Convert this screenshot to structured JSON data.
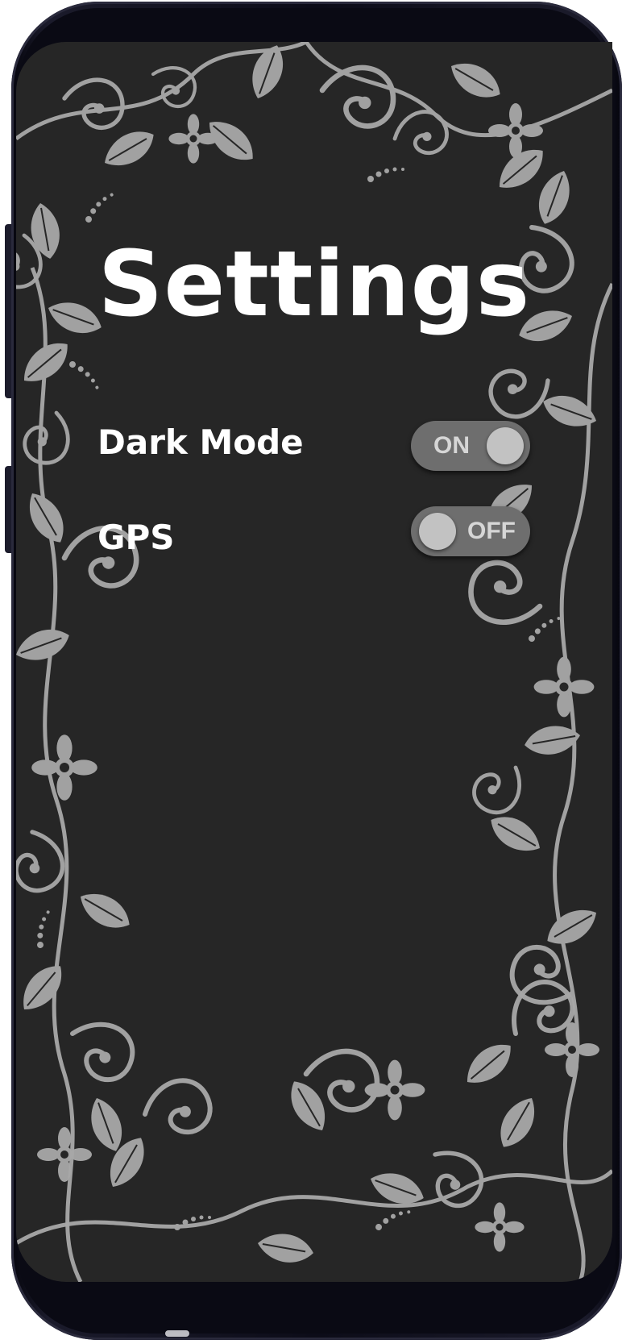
{
  "screen": {
    "title": "Settings",
    "settings": [
      {
        "label": "Dark Mode",
        "toggle_state": "ON",
        "enabled": true
      },
      {
        "label": "GPS",
        "toggle_state": "OFF",
        "enabled": false
      }
    ]
  },
  "colors": {
    "background": "#262626",
    "ornament": "#a8a8a8",
    "text": "#ffffff",
    "toggle_track": "#6e6e6e",
    "toggle_knob": "#c2c2c2",
    "phone_frame": "#0c0c18"
  },
  "icons": {
    "background": "floral-ornament-pattern"
  }
}
